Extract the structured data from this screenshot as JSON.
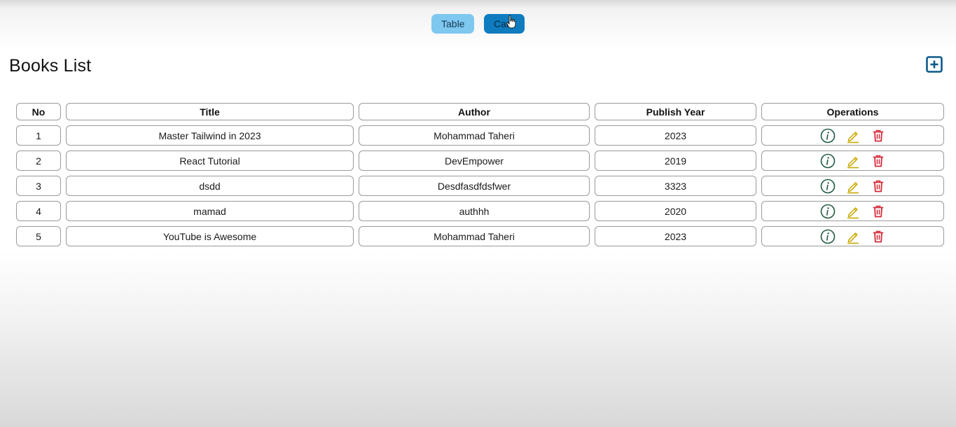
{
  "view_toggle": {
    "table_label": "Table",
    "card_label": "Card"
  },
  "header": {
    "title": "Books List",
    "add_icon": "plus-square-icon"
  },
  "table": {
    "columns": [
      "No",
      "Title",
      "Author",
      "Publish Year",
      "Operations"
    ],
    "rows": [
      {
        "no": "1",
        "title": "Master Tailwind in 2023",
        "author": "Mohammad Taheri",
        "year": "2023"
      },
      {
        "no": "2",
        "title": "React Tutorial",
        "author": "DevEmpower",
        "year": "2019"
      },
      {
        "no": "3",
        "title": "dsdd",
        "author": "Desdfasdfdsfwer",
        "year": "3323"
      },
      {
        "no": "4",
        "title": "mamad",
        "author": "authhh",
        "year": "2020"
      },
      {
        "no": "5",
        "title": "YouTube is Awesome",
        "author": "Mohammad Taheri",
        "year": "2023"
      }
    ],
    "operation_icons": [
      "info-circle-icon",
      "pencil-icon",
      "trash-icon"
    ]
  },
  "colors": {
    "toggle_table_bg": "#7ec8f0",
    "toggle_card_bg": "#0f7cc0",
    "add_icon": "#0d5a8c",
    "info_icon": "#1f5a3f",
    "edit_icon": "#c9a800",
    "delete_icon": "#d42a3a",
    "cell_border": "#9a9a9a"
  }
}
